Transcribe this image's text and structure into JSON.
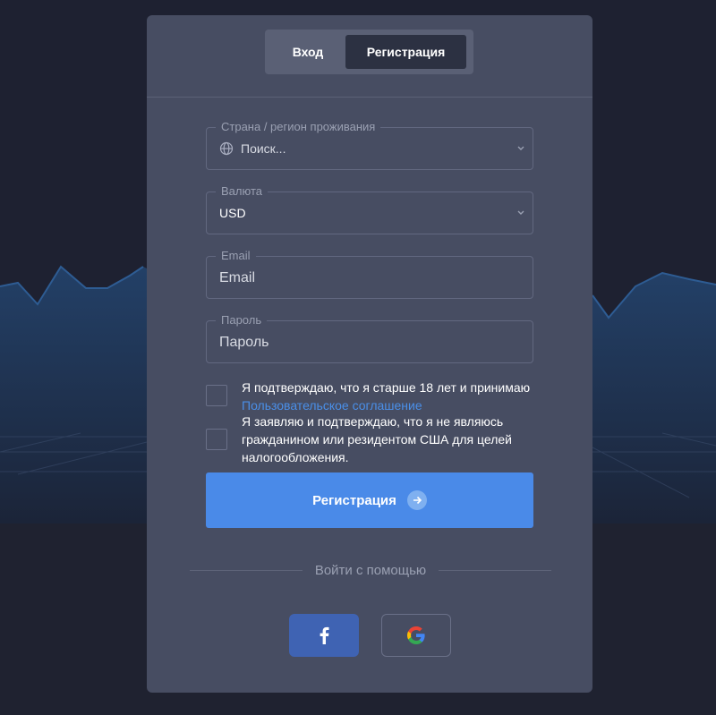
{
  "tabs": {
    "login_label": "Вход",
    "register_label": "Регистрация"
  },
  "form": {
    "country": {
      "label": "Страна / регион проживания",
      "placeholder": "Поиск..."
    },
    "currency": {
      "label": "Валюта",
      "value": "USD"
    },
    "email": {
      "label": "Email",
      "placeholder": "Email"
    },
    "password": {
      "label": "Пароль",
      "placeholder": "Пароль"
    },
    "age_consent": {
      "text": "Я подтверждаю, что я старше 18 лет и принимаю",
      "link": "Пользовательское соглашение"
    },
    "us_declaration": {
      "text": "Я заявляю и подтверждаю, что я не являюсь гражданином или резидентом США для целей налогообложения."
    },
    "submit_label": "Регистрация"
  },
  "social": {
    "divider_text": "Войти с помощью",
    "facebook_icon": "facebook-icon",
    "google_icon": "google-icon"
  },
  "colors": {
    "accent": "#4a8ae8",
    "facebook": "#3f63b3",
    "card": "#474d62",
    "link": "#4a8fe8"
  }
}
